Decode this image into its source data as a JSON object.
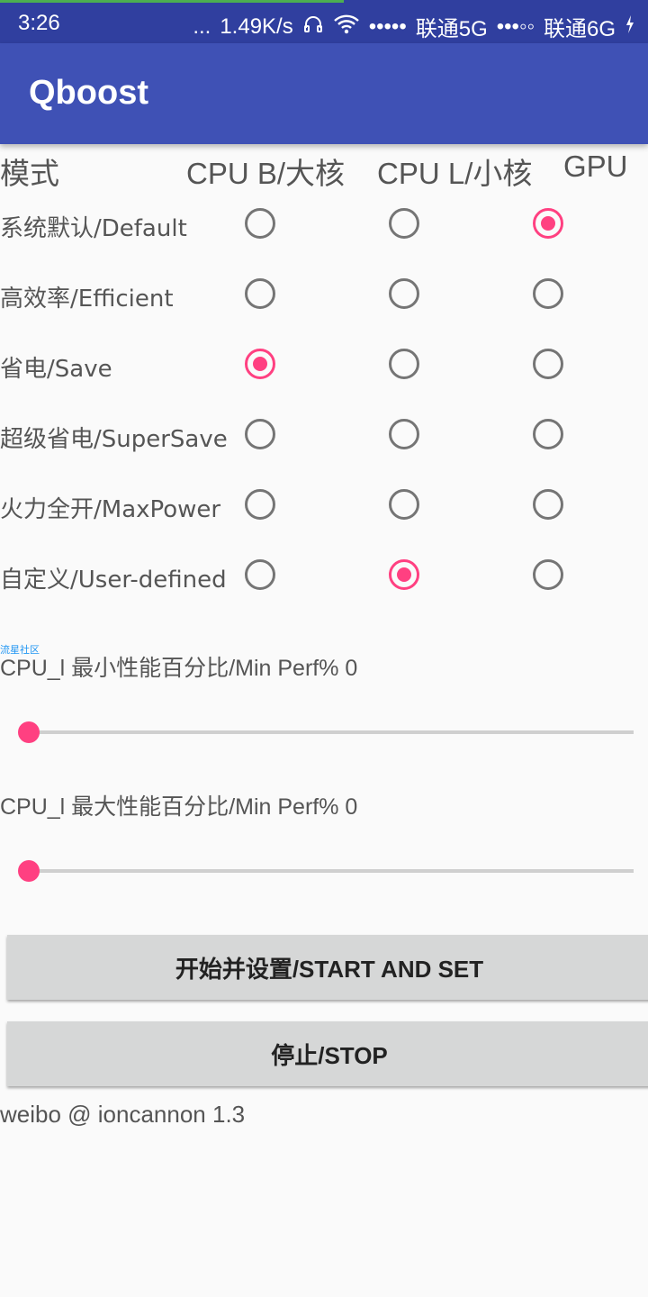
{
  "status_bar": {
    "time": "3:26",
    "dots": "...",
    "net_speed": "1.49K/s",
    "signal1": "•••••",
    "carrier1": "联通5G",
    "signal2": "•••◦◦",
    "carrier2": "联通6G",
    "icons": [
      "headset-icon",
      "wifi-icon",
      "charging-icon"
    ],
    "download_progress": 0.53
  },
  "app": {
    "title": "Qboost"
  },
  "table": {
    "headers": {
      "mode": "模式",
      "cpu_big": "CPU B/大核",
      "cpu_little": "CPU L/小核",
      "gpu": "GPU"
    },
    "rows": [
      {
        "label": "系统默认/Default",
        "cpu_big": false,
        "cpu_little": false,
        "gpu": true
      },
      {
        "label": "高效率/Efficient",
        "cpu_big": false,
        "cpu_little": false,
        "gpu": false
      },
      {
        "label": "省电/Save",
        "cpu_big": true,
        "cpu_little": false,
        "gpu": false
      },
      {
        "label": "超级省电/SuperSave",
        "cpu_big": false,
        "cpu_little": false,
        "gpu": false
      },
      {
        "label": "火力全开/MaxPower",
        "cpu_big": false,
        "cpu_little": false,
        "gpu": false
      },
      {
        "label": "自定义/User-defined",
        "cpu_big": false,
        "cpu_little": true,
        "gpu": false
      }
    ]
  },
  "watermark": "流星社区",
  "sliders": {
    "min_perf": {
      "label": "CPU_l 最小性能百分比/Min Perf% 0",
      "value": 0
    },
    "max_perf": {
      "label": "CPU_l 最大性能百分比/Min Perf% 0",
      "value": 0
    }
  },
  "buttons": {
    "start": "开始并设置/START AND SET",
    "stop": "停止/STOP"
  },
  "footer": "weibo @ ioncannon 1.3",
  "colors": {
    "status_bar": "#303f9f",
    "app_bar": "#3f51b5",
    "accent": "#ff4081",
    "radio_off": "#757575"
  }
}
